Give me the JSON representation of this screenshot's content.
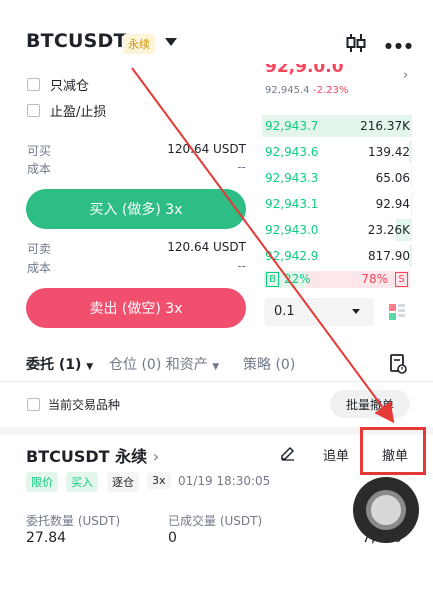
{
  "header": {
    "symbol": "BTCUSDT",
    "badge": "永续"
  },
  "form": {
    "reduce_only_label": "只减仓",
    "tp_sl_label": "止盈/止损",
    "buy_available_label": "可买",
    "buy_available_value": "120.64 USDT",
    "buy_cost_label": "成本",
    "buy_cost_value": "--",
    "buy_button": "买入 (做多) 3x",
    "sell_available_label": "可卖",
    "sell_available_value": "120.64 USDT",
    "sell_cost_label": "成本",
    "sell_cost_value": "--",
    "sell_button": "卖出 (做空) 3x"
  },
  "orderbook": {
    "last_price_partial": "92,9.0.0",
    "mark_price": "92,945.4",
    "change": "-2.23%",
    "bids": [
      {
        "price": "92,943.7",
        "qty": "216.37K",
        "depth": 1.0
      },
      {
        "price": "92,943.6",
        "qty": "139.42",
        "depth": 0.02
      },
      {
        "price": "92,943.3",
        "qty": "65.06",
        "depth": 0.01
      },
      {
        "price": "92,943.1",
        "qty": "92.94",
        "depth": 0.01
      },
      {
        "price": "92,943.0",
        "qty": "23.26K",
        "depth": 0.11
      },
      {
        "price": "92,942.9",
        "qty": "817.90",
        "depth": 0.02
      }
    ],
    "buy_letter": "B",
    "buy_ratio": "22%",
    "sell_ratio": "78%",
    "sell_letter": "S",
    "tick_size": "0.1"
  },
  "tabs": {
    "orders": "委托 (1)",
    "positions": "仓位 (0) 和资产",
    "strategies": "策略 (0)"
  },
  "filter": {
    "current_symbol_label": "当前交易品种",
    "batch_cancel": "批量撤单"
  },
  "order": {
    "title": "BTCUSDT 永续",
    "add_button": "追单",
    "cancel_button": "撤单",
    "tag_limit": "限价",
    "tag_buy": "买入",
    "tag_isolated": "逐仓",
    "tag_leverage": "3x",
    "time": "01/19 18:30:05",
    "qty_label": "委托数量 (USDT)",
    "qty_value": "27.84",
    "filled_label": "已成交量 (USDT)",
    "filled_value": "0",
    "price_value_partial": "7,000"
  },
  "colors": {
    "green": "#0ecb81",
    "red": "#f6465d",
    "annotation_red": "#e53935",
    "buy_button": "#2ebd85",
    "sell_button": "#f0506e"
  }
}
